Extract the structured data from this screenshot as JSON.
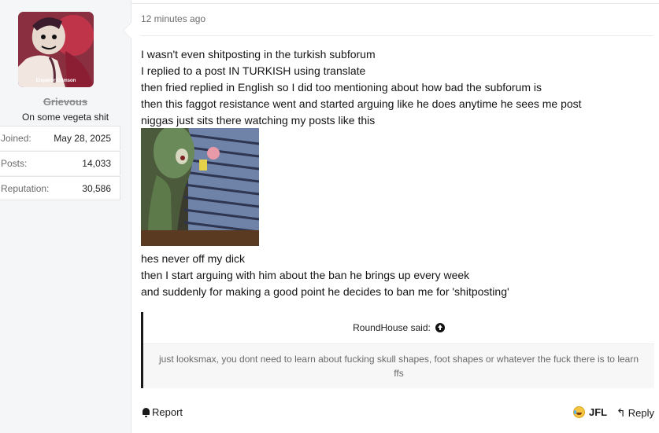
{
  "user": {
    "avatar_caption": "Emperor Crimson",
    "username": "Grievous",
    "title": "On some vegeta shit",
    "stats": [
      {
        "label": "Joined:",
        "value": "May 28, 2025"
      },
      {
        "label": "Posts:",
        "value": "14,033"
      },
      {
        "label": "Reputation:",
        "value": "30,586"
      }
    ]
  },
  "post": {
    "date": "12 minutes ago",
    "lines_top": [
      "I wasn't even shitposting in the turkish subforum",
      "I replied to a post IN TURKISH using translate",
      "then fried replied in English so I did too mentioning about how bad the subforum is",
      "then this faggot resistance went and started arguing like he does anytime he sees me post",
      "niggas just sits there watching my posts like this"
    ],
    "lines_bottom": [
      "hes never off my dick",
      "then I start arguing with him about the ban he brings up every week",
      "and suddenly for making a good point he decides to ban me for 'shitposting'"
    ]
  },
  "quote": {
    "author": "RoundHouse said:",
    "body": "just looksmax, you dont need to learn about fucking skull shapes, foot shapes or whatever the fuck there is to learn ffs"
  },
  "actions": {
    "report": "Report",
    "reaction": "JFL",
    "reply": "Reply"
  },
  "icons": {
    "report": "bell-icon",
    "reaction": "laughing-emoji-icon",
    "reply": "reply-arrow-icon",
    "quote_jump": "arrow-up-circle-icon"
  }
}
